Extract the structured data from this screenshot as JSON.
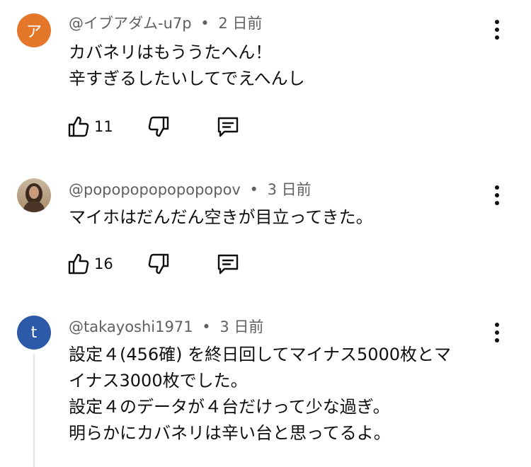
{
  "comments": [
    {
      "avatar_letter": "ア",
      "author": "@イブアダム-u7p",
      "separator": "•",
      "time": "2 日前",
      "lines": [
        "カバネリはもううたへん！",
        "辛すぎるしたいしてでえへんし"
      ],
      "likes": "11",
      "avatar_color": "#e4772a"
    },
    {
      "avatar_letter": "",
      "author": "@popopopopopopopov",
      "separator": "•",
      "time": "3 日前",
      "lines": [
        "マイホはだんだん空きが目立ってきた。"
      ],
      "likes": "16"
    },
    {
      "avatar_letter": "t",
      "author": "@takayoshi1971",
      "separator": "•",
      "time": "3 日前",
      "lines": [
        "設定４(456確) を終日回してマイナス5000枚とマ",
        "イナス3000枚でした。",
        "設定４のデータが４台だけって少な過ぎ。",
        "明らかにカバネリは辛い台と思ってるよ。"
      ],
      "avatar_color": "#2d5aa8"
    }
  ],
  "icons": {
    "like": "thumbs-up-icon",
    "dislike": "thumbs-down-icon",
    "reply": "comment-icon",
    "more": "more-vert-icon"
  }
}
